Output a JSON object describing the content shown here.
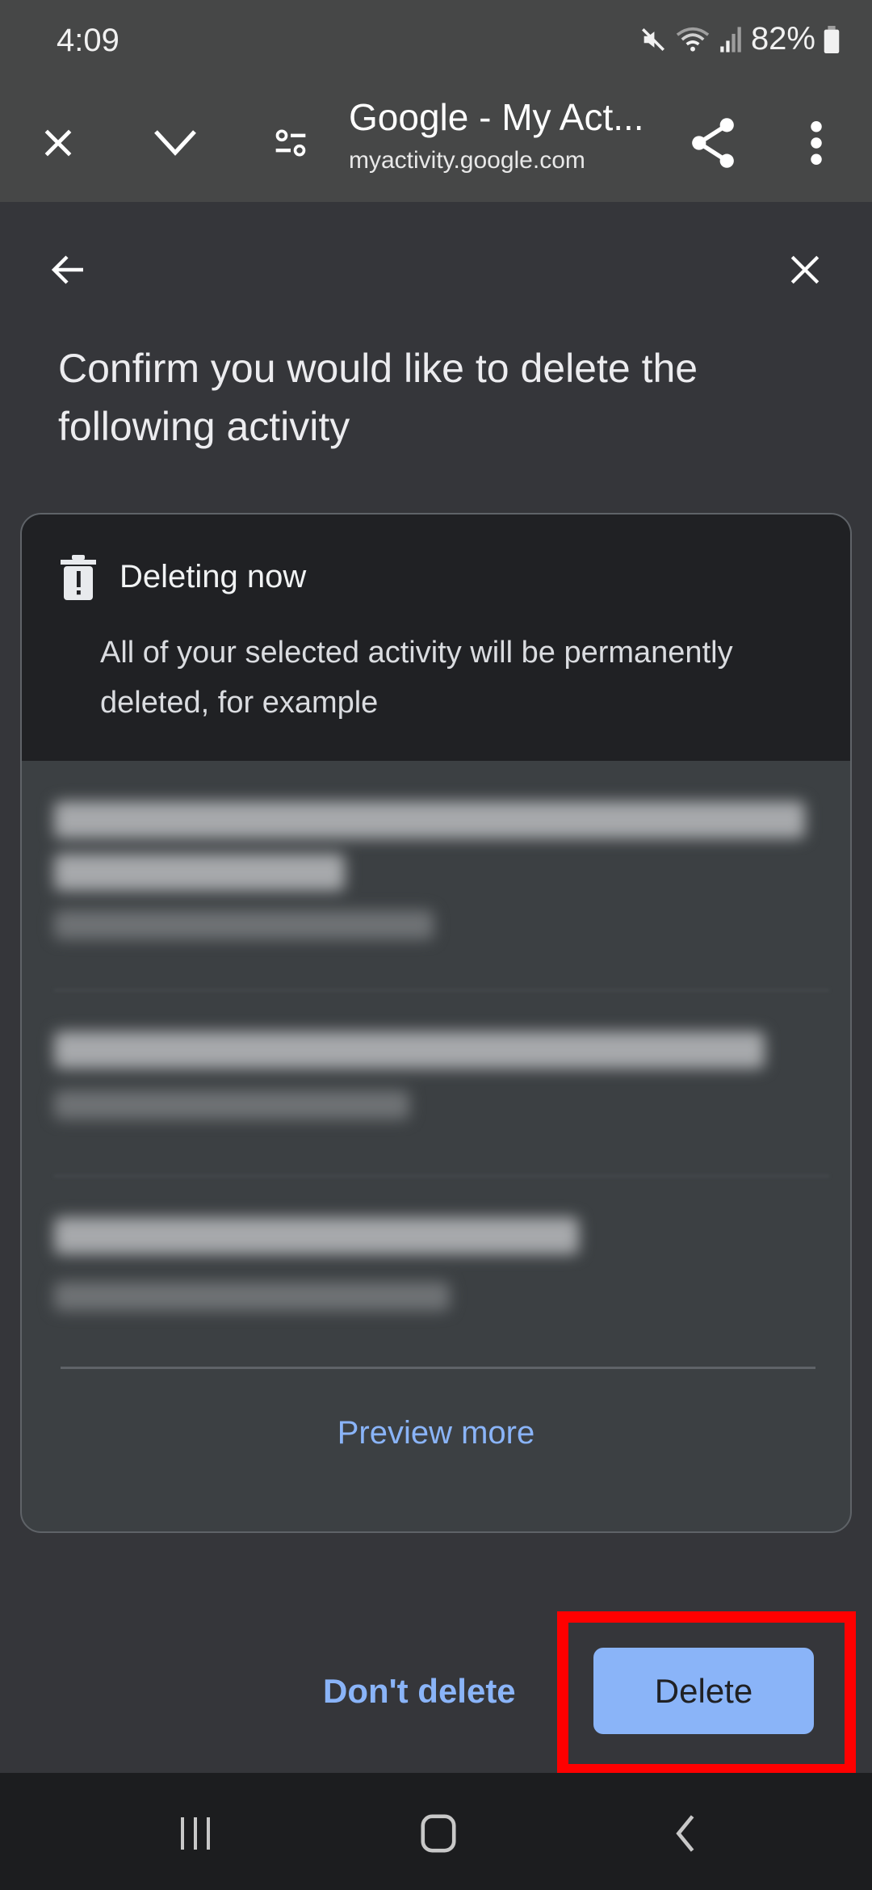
{
  "status_bar": {
    "time": "4:09",
    "battery_percent": "82%",
    "icons": [
      "mute-icon",
      "wifi-icon",
      "signal-icon",
      "battery-icon"
    ]
  },
  "browser_toolbar": {
    "page_title": "Google - My Act...",
    "page_url": "myactivity.google.com",
    "icons": [
      "close-icon",
      "chevron-down-icon",
      "site-settings-icon",
      "share-icon",
      "more-vert-icon"
    ]
  },
  "dialog": {
    "title": "Confirm you would like to delete the following activity",
    "card": {
      "header_title": "Deleting now",
      "header_icon": "trash-warning-icon",
      "description": "All of your selected activity will be permanently deleted, for example",
      "items": [
        {
          "title": "[blurred activity title]",
          "subtitle": "[blurred date]"
        },
        {
          "title": "[blurred activity title]",
          "subtitle": "[blurred date]"
        },
        {
          "title": "[blurred activity title]",
          "subtitle": "[blurred date]"
        }
      ],
      "preview_more_label": "Preview more"
    },
    "dont_delete_label": "Don't delete",
    "delete_label": "Delete"
  },
  "colors": {
    "accent": "#8ab4f8",
    "highlight": "#ff0000",
    "sheet_bg": "#35363a",
    "card_header_bg": "#202124"
  },
  "nav_bar": {
    "icons": [
      "recents-icon",
      "home-icon",
      "back-icon"
    ]
  }
}
